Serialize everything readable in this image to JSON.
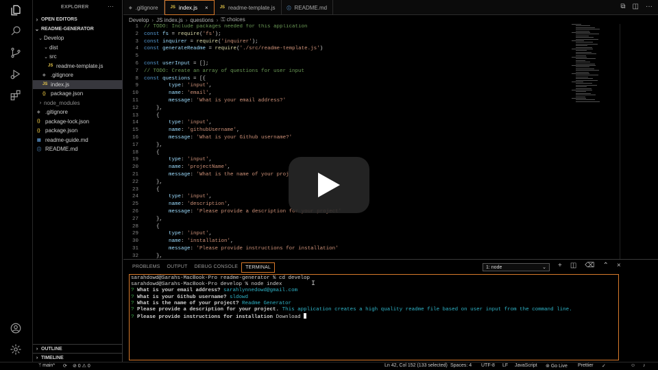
{
  "sidebar": {
    "title": "EXPLORER",
    "open_editors": "OPEN EDITORS",
    "project": "README-GENERATOR",
    "tree": [
      {
        "label": "Develop",
        "kind": "folder",
        "depth": 0,
        "open": true
      },
      {
        "label": "dist",
        "kind": "folder",
        "depth": 1,
        "open": true
      },
      {
        "label": "src",
        "kind": "folder",
        "depth": 1,
        "open": true
      },
      {
        "label": "readme-template.js",
        "kind": "js",
        "depth": 2
      },
      {
        "label": ".gitignore",
        "kind": "git",
        "depth": 1
      },
      {
        "label": "index.js",
        "kind": "js",
        "depth": 1,
        "selected": true
      },
      {
        "label": "package.json",
        "kind": "json",
        "depth": 1
      },
      {
        "label": "node_modules",
        "kind": "folder",
        "depth": 0,
        "open": false,
        "dim": true
      },
      {
        "label": ".gitignore",
        "kind": "git",
        "depth": 0
      },
      {
        "label": "package-lock.json",
        "kind": "json",
        "depth": 0
      },
      {
        "label": "package.json",
        "kind": "json",
        "depth": 0
      },
      {
        "label": "readme-guide.md",
        "kind": "md",
        "depth": 0
      },
      {
        "label": "README.md",
        "kind": "info",
        "depth": 0
      }
    ],
    "outline": "OUTLINE",
    "timeline": "TIMELINE"
  },
  "tabs": [
    {
      "label": ".gitignore",
      "icon": "git-icon",
      "active": false
    },
    {
      "label": "index.js",
      "icon": "js-file-icon",
      "active": true
    },
    {
      "label": "readme-template.js",
      "icon": "js-file-icon",
      "active": false
    },
    {
      "label": "README.md",
      "icon": "info-icon",
      "active": false
    }
  ],
  "breadcrumb": [
    "Develop",
    "index.js",
    "questions",
    "choices"
  ],
  "code": [
    {
      "n": "1",
      "t": [
        [
          "c",
          "// TODO: Include packages needed for this application"
        ]
      ]
    },
    {
      "n": "2",
      "t": [
        [
          "k",
          "const "
        ],
        [
          "v",
          "fs"
        ],
        [
          "o",
          " = "
        ],
        [
          "f",
          "require"
        ],
        [
          "p",
          "("
        ],
        [
          "s",
          "'fs'"
        ],
        [
          "p",
          ");"
        ]
      ]
    },
    {
      "n": "3",
      "t": [
        [
          "k",
          "const "
        ],
        [
          "v",
          "inquirer"
        ],
        [
          "o",
          " = "
        ],
        [
          "f",
          "require"
        ],
        [
          "p",
          "("
        ],
        [
          "s",
          "'inquirer'"
        ],
        [
          "p",
          ");"
        ]
      ]
    },
    {
      "n": "4",
      "t": [
        [
          "k",
          "const "
        ],
        [
          "v",
          "generateReadme"
        ],
        [
          "o",
          " = "
        ],
        [
          "f",
          "require"
        ],
        [
          "p",
          "("
        ],
        [
          "s",
          "'./src/readme-template.js'"
        ],
        [
          "p",
          ")"
        ]
      ]
    },
    {
      "n": "5",
      "t": []
    },
    {
      "n": "6",
      "t": [
        [
          "k",
          "const "
        ],
        [
          "v",
          "userInput"
        ],
        [
          "o",
          " = "
        ],
        [
          "p",
          "[];"
        ]
      ]
    },
    {
      "n": "7",
      "t": [
        [
          "c",
          "// TODO: Create an array of questions for user input"
        ]
      ]
    },
    {
      "n": "8",
      "t": [
        [
          "k",
          "const "
        ],
        [
          "v",
          "questions"
        ],
        [
          "o",
          " = "
        ],
        [
          "p",
          "[{"
        ]
      ]
    },
    {
      "n": "9",
      "t": [
        [
          "p",
          "        "
        ],
        [
          "v",
          "type"
        ],
        [
          "p",
          ": "
        ],
        [
          "s",
          "'input'"
        ],
        [
          "p",
          ","
        ]
      ]
    },
    {
      "n": "10",
      "t": [
        [
          "p",
          "        "
        ],
        [
          "v",
          "name"
        ],
        [
          "p",
          ": "
        ],
        [
          "s",
          "'email'"
        ],
        [
          "p",
          ","
        ]
      ]
    },
    {
      "n": "11",
      "t": [
        [
          "p",
          "        "
        ],
        [
          "v",
          "message"
        ],
        [
          "p",
          ": "
        ],
        [
          "s",
          "'What is your email address?'"
        ]
      ]
    },
    {
      "n": "12",
      "t": [
        [
          "p",
          "    },"
        ]
      ]
    },
    {
      "n": "13",
      "t": [
        [
          "p",
          "    {"
        ]
      ]
    },
    {
      "n": "14",
      "t": [
        [
          "p",
          "        "
        ],
        [
          "v",
          "type"
        ],
        [
          "p",
          ": "
        ],
        [
          "s",
          "'input'"
        ],
        [
          "p",
          ","
        ]
      ]
    },
    {
      "n": "15",
      "t": [
        [
          "p",
          "        "
        ],
        [
          "v",
          "name"
        ],
        [
          "p",
          ": "
        ],
        [
          "s",
          "'githubUsername'"
        ],
        [
          "p",
          ","
        ]
      ]
    },
    {
      "n": "16",
      "t": [
        [
          "p",
          "        "
        ],
        [
          "v",
          "message"
        ],
        [
          "p",
          ": "
        ],
        [
          "s",
          "'What is your Github username?'"
        ]
      ]
    },
    {
      "n": "17",
      "t": [
        [
          "p",
          "    },"
        ]
      ]
    },
    {
      "n": "18",
      "t": [
        [
          "p",
          "    {"
        ]
      ]
    },
    {
      "n": "19",
      "t": [
        [
          "p",
          "        "
        ],
        [
          "v",
          "type"
        ],
        [
          "p",
          ": "
        ],
        [
          "s",
          "'input'"
        ],
        [
          "p",
          ","
        ]
      ]
    },
    {
      "n": "20",
      "t": [
        [
          "p",
          "        "
        ],
        [
          "v",
          "name"
        ],
        [
          "p",
          ": "
        ],
        [
          "s",
          "'projectName'"
        ],
        [
          "p",
          ","
        ]
      ]
    },
    {
      "n": "21",
      "t": [
        [
          "p",
          "        "
        ],
        [
          "v",
          "message"
        ],
        [
          "p",
          ": "
        ],
        [
          "s",
          "'What is the name of your proj"
        ]
      ]
    },
    {
      "n": "22",
      "t": [
        [
          "p",
          "    },"
        ]
      ]
    },
    {
      "n": "23",
      "t": [
        [
          "p",
          "    {"
        ]
      ]
    },
    {
      "n": "24",
      "t": [
        [
          "p",
          "        "
        ],
        [
          "v",
          "type"
        ],
        [
          "p",
          ": "
        ],
        [
          "s",
          "'input'"
        ],
        [
          "p",
          ","
        ]
      ]
    },
    {
      "n": "25",
      "t": [
        [
          "p",
          "        "
        ],
        [
          "v",
          "name"
        ],
        [
          "p",
          ": "
        ],
        [
          "s",
          "'description'"
        ],
        [
          "p",
          ","
        ]
      ]
    },
    {
      "n": "26",
      "t": [
        [
          "p",
          "        "
        ],
        [
          "v",
          "message"
        ],
        [
          "p",
          ": "
        ],
        [
          "s",
          "'Please provide a description for your project'"
        ]
      ]
    },
    {
      "n": "27",
      "t": [
        [
          "p",
          "    },"
        ]
      ]
    },
    {
      "n": "28",
      "t": [
        [
          "p",
          "    {"
        ]
      ]
    },
    {
      "n": "29",
      "t": [
        [
          "p",
          "        "
        ],
        [
          "v",
          "type"
        ],
        [
          "p",
          ": "
        ],
        [
          "s",
          "'input'"
        ],
        [
          "p",
          ","
        ]
      ]
    },
    {
      "n": "30",
      "t": [
        [
          "p",
          "        "
        ],
        [
          "v",
          "name"
        ],
        [
          "p",
          ": "
        ],
        [
          "s",
          "'installation'"
        ],
        [
          "p",
          ","
        ]
      ]
    },
    {
      "n": "31",
      "t": [
        [
          "p",
          "        "
        ],
        [
          "v",
          "message"
        ],
        [
          "p",
          ": "
        ],
        [
          "s",
          "'Please provide instructions for installation'"
        ]
      ]
    },
    {
      "n": "32",
      "t": [
        [
          "p",
          "    },"
        ]
      ]
    }
  ],
  "panel": {
    "tabs": [
      {
        "label": "PROBLEMS",
        "active": false
      },
      {
        "label": "OUTPUT",
        "active": false
      },
      {
        "label": "DEBUG CONSOLE",
        "active": false
      },
      {
        "label": "TERMINAL",
        "active": true
      }
    ],
    "terminal_select": "1: node",
    "terminal_lines": [
      [
        [
          "n",
          "sarahdowd@Sarahs-MacBook-Pro readme-generator % cd develop"
        ]
      ],
      [
        [
          "n",
          "sarahdowd@Sarahs-MacBook-Pro develop % node index"
        ]
      ],
      [
        [
          "q",
          "? "
        ],
        [
          "b",
          "What is your email address? "
        ],
        [
          "a",
          "sarahlynnedowd@gmail.com"
        ]
      ],
      [
        [
          "q",
          "? "
        ],
        [
          "b",
          "What is your Github username? "
        ],
        [
          "a",
          "sldowd"
        ]
      ],
      [
        [
          "q",
          "? "
        ],
        [
          "b",
          "What is the name of your project? "
        ],
        [
          "a",
          "Readme Generator"
        ]
      ],
      [
        [
          "q",
          "? "
        ],
        [
          "b",
          "Please provide a description for your project. "
        ],
        [
          "a",
          "This application creates a high quality readme file based on user input from the command line."
        ]
      ],
      [
        [
          "q",
          "? "
        ],
        [
          "b",
          "Please provide instructions for installation "
        ],
        [
          "n",
          "Download "
        ]
      ]
    ]
  },
  "status": {
    "branch": "main*",
    "problems": "⊘ 0 ⚠ 0",
    "position": "Ln 42, Col 152 (133 selected)",
    "spaces": "Spaces: 4",
    "encoding": "UTF-8",
    "eol": "LF",
    "language": "JavaScript",
    "golive": "Go Live",
    "prettier": "Prettier"
  }
}
